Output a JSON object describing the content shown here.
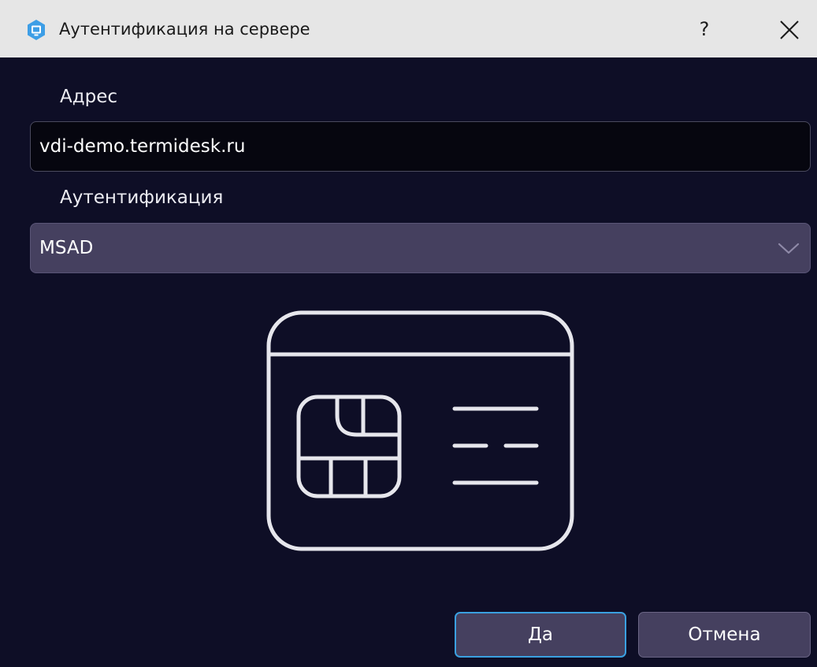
{
  "window": {
    "title": "Аутентификация на сервере",
    "app_icon": "termidesk-logo-icon",
    "help_label": "?",
    "close_icon": "close-icon"
  },
  "address": {
    "label": "Адрес",
    "value": "vdi-demo.termidesk.ru"
  },
  "auth": {
    "label": "Аутентификация",
    "selected": "MSAD",
    "dropdown_icon": "chevron-down-icon"
  },
  "illustration": {
    "icon": "smart-card-icon"
  },
  "buttons": {
    "ok_label": "Да",
    "cancel_label": "Отмена"
  },
  "colors": {
    "background": "#0e0e26",
    "titlebar": "#e6e6e6",
    "button_fill": "#45405f",
    "focus_accent": "#3aa0e0",
    "illustration_stroke": "#e6e6ec"
  }
}
